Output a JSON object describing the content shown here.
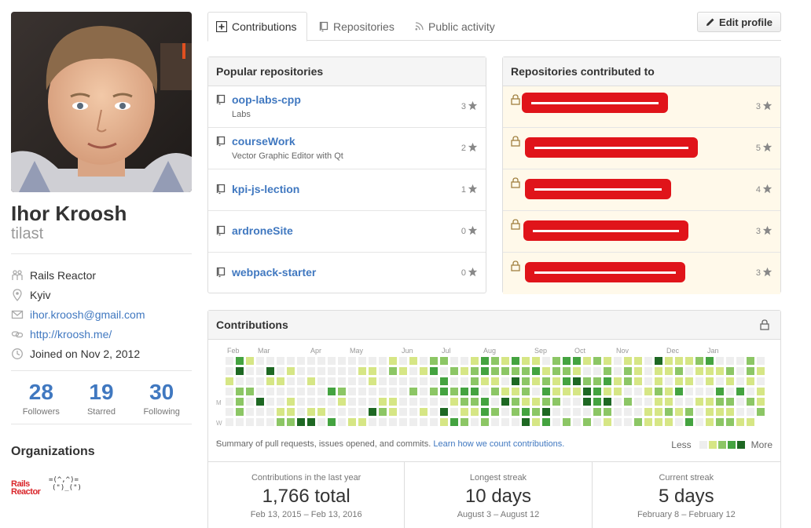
{
  "profile": {
    "fullname": "Ihor Kroosh",
    "username": "tilast",
    "details": [
      {
        "icon": "organization-icon",
        "text": "Rails Reactor",
        "link": false
      },
      {
        "icon": "location-icon",
        "text": "Kyiv",
        "link": false
      },
      {
        "icon": "mail-icon",
        "text": "ihor.kroosh@gmail.com",
        "link": true
      },
      {
        "icon": "link-icon",
        "text": "http://kroosh.me/",
        "link": true
      },
      {
        "icon": "clock-icon",
        "text": "Joined on Nov 2, 2012",
        "link": false
      }
    ],
    "stats": [
      {
        "num": "28",
        "label": "Followers"
      },
      {
        "num": "19",
        "label": "Starred"
      },
      {
        "num": "30",
        "label": "Following"
      }
    ],
    "orgs_title": "Organizations",
    "orgs": [
      {
        "name": "Rails Reactor",
        "line1": "Rails",
        "line2": "Reactor"
      },
      {
        "art1": "=(^,^)=",
        "art2": "(\")_(\")"
      }
    ]
  },
  "tabs": [
    {
      "label": "Contributions",
      "icon": "diff-added-icon",
      "selected": true
    },
    {
      "label": "Repositories",
      "icon": "repo-icon",
      "selected": false
    },
    {
      "label": "Public activity",
      "icon": "rss-icon",
      "selected": false
    }
  ],
  "edit_profile": "Edit profile",
  "popular": {
    "title": "Popular repositories",
    "repos": [
      {
        "name": "oop-labs-cpp",
        "desc": "Labs",
        "stars": "3"
      },
      {
        "name": "courseWork",
        "desc": "Vector Graphic Editor with Qt",
        "stars": "2"
      },
      {
        "name": "kpi-js-lection",
        "desc": "",
        "stars": "1"
      },
      {
        "name": "ardroneSite",
        "desc": "",
        "stars": "0"
      },
      {
        "name": "webpack-starter",
        "desc": "",
        "stars": "0"
      }
    ]
  },
  "contributed": {
    "title": "Repositories contributed to",
    "repos": [
      {
        "stars": "3"
      },
      {
        "stars": "5"
      },
      {
        "stars": "4"
      },
      {
        "stars": "3"
      },
      {
        "stars": "3"
      }
    ]
  },
  "contributions": {
    "title": "Contributions",
    "months": [
      "Feb",
      "Mar",
      "Apr",
      "May",
      "Jun",
      "Jul",
      "Aug",
      "Sep",
      "Oct",
      "Nov",
      "Dec",
      "Jan"
    ],
    "weekdays": [
      "M",
      "W",
      "F"
    ],
    "footer_text": "Summary of pull requests, issues opened, and commits.",
    "footer_link": "Learn how we count contributions.",
    "legend_less": "Less",
    "legend_more": "More",
    "colors": [
      "#eeeeee",
      "#d6e685",
      "#8cc665",
      "#44a340",
      "#1e6823"
    ],
    "summary": [
      {
        "label": "Contributions in the last year",
        "value": "1,766 total",
        "range": "Feb 13, 2015 – Feb 13, 2016"
      },
      {
        "label": "Longest streak",
        "value": "10 days",
        "range": "August 3 – August 12"
      },
      {
        "label": "Current streak",
        "value": "5 days",
        "range": "February 8 – February 12"
      }
    ]
  }
}
